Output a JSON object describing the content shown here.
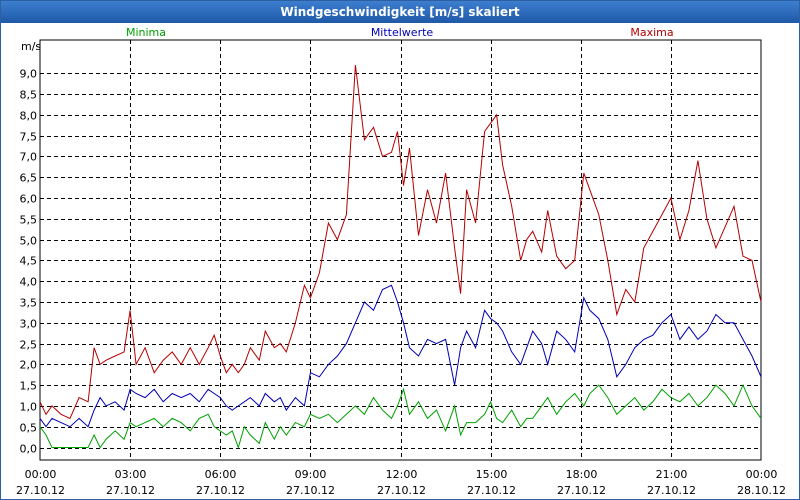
{
  "window": {
    "title": "Windgeschwindigkeit [m/s] skaliert"
  },
  "chart_data": {
    "type": "line",
    "title": "Windgeschwindigkeit [m/s] skaliert",
    "ylabel": "m/s",
    "ylim": [
      -0.3,
      9.8
    ],
    "xlim": [
      0,
      24
    ],
    "grid": true,
    "legend_placement": "top",
    "y_ticks": [
      "0,0",
      "0,5",
      "1,0",
      "1,5",
      "2,0",
      "2,5",
      "3,0",
      "3,5",
      "4,0",
      "4,5",
      "5,0",
      "5,5",
      "6,0",
      "6,5",
      "7,0",
      "7,5",
      "8,0",
      "8,5",
      "9,0"
    ],
    "x_ticks": [
      {
        "time": "00:00",
        "date": "27.10.12"
      },
      {
        "time": "03:00",
        "date": "27.10.12"
      },
      {
        "time": "06:00",
        "date": "27.10.12"
      },
      {
        "time": "09:00",
        "date": "27.10.12"
      },
      {
        "time": "12:00",
        "date": "27.10.12"
      },
      {
        "time": "15:00",
        "date": "27.10.12"
      },
      {
        "time": "18:00",
        "date": "27.10.12"
      },
      {
        "time": "21:00",
        "date": "27.10.12"
      },
      {
        "time": "00:00",
        "date": "28.10.12"
      }
    ],
    "series": [
      {
        "name": "Minima",
        "color": "#00a000",
        "points": [
          [
            0.0,
            0.5
          ],
          [
            0.2,
            0.3
          ],
          [
            0.4,
            0.0
          ],
          [
            0.7,
            0.0
          ],
          [
            1.0,
            0.0
          ],
          [
            1.3,
            0.0
          ],
          [
            1.6,
            0.0
          ],
          [
            1.8,
            0.3
          ],
          [
            2.0,
            0.0
          ],
          [
            2.2,
            0.2
          ],
          [
            2.5,
            0.4
          ],
          [
            2.8,
            0.2
          ],
          [
            3.0,
            0.6
          ],
          [
            3.2,
            0.5
          ],
          [
            3.5,
            0.6
          ],
          [
            3.8,
            0.7
          ],
          [
            4.1,
            0.5
          ],
          [
            4.4,
            0.7
          ],
          [
            4.7,
            0.6
          ],
          [
            5.0,
            0.4
          ],
          [
            5.3,
            0.7
          ],
          [
            5.6,
            0.8
          ],
          [
            5.8,
            0.5
          ],
          [
            6.0,
            0.4
          ],
          [
            6.2,
            0.3
          ],
          [
            6.4,
            0.4
          ],
          [
            6.6,
            0.0
          ],
          [
            6.8,
            0.5
          ],
          [
            7.0,
            0.3
          ],
          [
            7.3,
            0.1
          ],
          [
            7.5,
            0.6
          ],
          [
            7.8,
            0.2
          ],
          [
            8.0,
            0.5
          ],
          [
            8.2,
            0.3
          ],
          [
            8.5,
            0.6
          ],
          [
            8.8,
            0.5
          ],
          [
            9.0,
            0.8
          ],
          [
            9.3,
            0.7
          ],
          [
            9.6,
            0.8
          ],
          [
            9.9,
            0.6
          ],
          [
            10.2,
            0.8
          ],
          [
            10.5,
            1.0
          ],
          [
            10.8,
            0.8
          ],
          [
            11.1,
            1.2
          ],
          [
            11.4,
            0.9
          ],
          [
            11.7,
            0.7
          ],
          [
            11.9,
            1.0
          ],
          [
            12.1,
            1.4
          ],
          [
            12.3,
            0.8
          ],
          [
            12.6,
            1.1
          ],
          [
            12.9,
            0.7
          ],
          [
            13.2,
            0.9
          ],
          [
            13.5,
            0.4
          ],
          [
            13.8,
            1.0
          ],
          [
            14.0,
            0.3
          ],
          [
            14.2,
            0.6
          ],
          [
            14.5,
            0.6
          ],
          [
            14.8,
            0.8
          ],
          [
            15.0,
            1.1
          ],
          [
            15.2,
            0.7
          ],
          [
            15.4,
            0.6
          ],
          [
            15.7,
            0.9
          ],
          [
            16.0,
            0.5
          ],
          [
            16.2,
            0.7
          ],
          [
            16.4,
            0.7
          ],
          [
            16.7,
            1.0
          ],
          [
            16.9,
            1.2
          ],
          [
            17.2,
            0.8
          ],
          [
            17.5,
            1.1
          ],
          [
            17.8,
            1.3
          ],
          [
            18.1,
            1.0
          ],
          [
            18.3,
            1.3
          ],
          [
            18.6,
            1.5
          ],
          [
            18.9,
            1.2
          ],
          [
            19.2,
            0.8
          ],
          [
            19.5,
            1.0
          ],
          [
            19.8,
            1.2
          ],
          [
            20.1,
            0.9
          ],
          [
            20.4,
            1.1
          ],
          [
            20.7,
            1.4
          ],
          [
            21.0,
            1.2
          ],
          [
            21.3,
            1.1
          ],
          [
            21.6,
            1.3
          ],
          [
            21.9,
            1.0
          ],
          [
            22.2,
            1.2
          ],
          [
            22.5,
            1.5
          ],
          [
            22.8,
            1.3
          ],
          [
            23.1,
            1.0
          ],
          [
            23.4,
            1.5
          ],
          [
            23.7,
            1.0
          ],
          [
            24.0,
            0.7
          ]
        ]
      },
      {
        "name": "Mittelwerte",
        "color": "#0000b4",
        "points": [
          [
            0.0,
            0.7
          ],
          [
            0.2,
            0.5
          ],
          [
            0.4,
            0.7
          ],
          [
            0.7,
            0.6
          ],
          [
            1.0,
            0.5
          ],
          [
            1.3,
            0.7
          ],
          [
            1.6,
            0.5
          ],
          [
            1.8,
            0.9
          ],
          [
            2.0,
            1.2
          ],
          [
            2.2,
            1.0
          ],
          [
            2.5,
            1.1
          ],
          [
            2.8,
            0.9
          ],
          [
            3.0,
            1.4
          ],
          [
            3.2,
            1.3
          ],
          [
            3.5,
            1.2
          ],
          [
            3.8,
            1.4
          ],
          [
            4.1,
            1.1
          ],
          [
            4.4,
            1.3
          ],
          [
            4.7,
            1.2
          ],
          [
            5.0,
            1.3
          ],
          [
            5.3,
            1.1
          ],
          [
            5.6,
            1.4
          ],
          [
            5.8,
            1.3
          ],
          [
            6.0,
            1.2
          ],
          [
            6.2,
            1.0
          ],
          [
            6.4,
            0.9
          ],
          [
            6.6,
            1.0
          ],
          [
            6.8,
            1.1
          ],
          [
            7.0,
            1.2
          ],
          [
            7.3,
            1.0
          ],
          [
            7.5,
            1.3
          ],
          [
            7.8,
            1.1
          ],
          [
            8.0,
            1.2
          ],
          [
            8.2,
            0.9
          ],
          [
            8.5,
            1.2
          ],
          [
            8.8,
            1.0
          ],
          [
            9.0,
            1.8
          ],
          [
            9.3,
            1.7
          ],
          [
            9.6,
            2.0
          ],
          [
            9.9,
            2.2
          ],
          [
            10.2,
            2.5
          ],
          [
            10.5,
            3.0
          ],
          [
            10.8,
            3.5
          ],
          [
            11.1,
            3.3
          ],
          [
            11.4,
            3.8
          ],
          [
            11.7,
            3.9
          ],
          [
            11.9,
            3.5
          ],
          [
            12.1,
            3.0
          ],
          [
            12.3,
            2.4
          ],
          [
            12.6,
            2.2
          ],
          [
            12.9,
            2.6
          ],
          [
            13.2,
            2.5
          ],
          [
            13.5,
            2.6
          ],
          [
            13.8,
            1.5
          ],
          [
            14.0,
            2.4
          ],
          [
            14.2,
            2.8
          ],
          [
            14.5,
            2.4
          ],
          [
            14.8,
            3.3
          ],
          [
            15.0,
            3.1
          ],
          [
            15.2,
            3.0
          ],
          [
            15.4,
            2.8
          ],
          [
            15.7,
            2.3
          ],
          [
            16.0,
            2.0
          ],
          [
            16.2,
            2.4
          ],
          [
            16.4,
            2.8
          ],
          [
            16.7,
            2.5
          ],
          [
            16.9,
            2.0
          ],
          [
            17.2,
            2.8
          ],
          [
            17.5,
            2.6
          ],
          [
            17.8,
            2.3
          ],
          [
            18.1,
            3.6
          ],
          [
            18.3,
            3.3
          ],
          [
            18.6,
            3.1
          ],
          [
            18.9,
            2.6
          ],
          [
            19.2,
            1.7
          ],
          [
            19.5,
            2.0
          ],
          [
            19.8,
            2.4
          ],
          [
            20.1,
            2.6
          ],
          [
            20.4,
            2.7
          ],
          [
            20.7,
            3.0
          ],
          [
            21.0,
            3.2
          ],
          [
            21.3,
            2.6
          ],
          [
            21.6,
            2.9
          ],
          [
            21.9,
            2.6
          ],
          [
            22.2,
            2.8
          ],
          [
            22.5,
            3.2
          ],
          [
            22.8,
            3.0
          ],
          [
            23.1,
            3.0
          ],
          [
            23.4,
            2.6
          ],
          [
            23.7,
            2.2
          ],
          [
            24.0,
            1.7
          ]
        ]
      },
      {
        "name": "Maxima",
        "color": "#b40000",
        "points": [
          [
            0.0,
            1.1
          ],
          [
            0.2,
            0.8
          ],
          [
            0.4,
            1.0
          ],
          [
            0.7,
            0.8
          ],
          [
            1.0,
            0.7
          ],
          [
            1.3,
            1.2
          ],
          [
            1.6,
            1.1
          ],
          [
            1.8,
            2.4
          ],
          [
            2.0,
            2.0
          ],
          [
            2.2,
            2.1
          ],
          [
            2.5,
            2.2
          ],
          [
            2.8,
            2.3
          ],
          [
            3.0,
            3.3
          ],
          [
            3.2,
            2.0
          ],
          [
            3.5,
            2.4
          ],
          [
            3.8,
            1.8
          ],
          [
            4.1,
            2.1
          ],
          [
            4.4,
            2.3
          ],
          [
            4.7,
            2.0
          ],
          [
            5.0,
            2.4
          ],
          [
            5.3,
            2.0
          ],
          [
            5.6,
            2.4
          ],
          [
            5.8,
            2.7
          ],
          [
            6.0,
            2.2
          ],
          [
            6.2,
            1.8
          ],
          [
            6.4,
            2.0
          ],
          [
            6.6,
            1.8
          ],
          [
            6.8,
            2.0
          ],
          [
            7.0,
            2.4
          ],
          [
            7.3,
            2.1
          ],
          [
            7.5,
            2.8
          ],
          [
            7.8,
            2.4
          ],
          [
            8.0,
            2.5
          ],
          [
            8.2,
            2.3
          ],
          [
            8.5,
            3.0
          ],
          [
            8.8,
            3.9
          ],
          [
            9.0,
            3.6
          ],
          [
            9.3,
            4.2
          ],
          [
            9.6,
            5.4
          ],
          [
            9.9,
            5.0
          ],
          [
            10.2,
            5.6
          ],
          [
            10.5,
            9.2
          ],
          [
            10.8,
            7.4
          ],
          [
            11.1,
            7.7
          ],
          [
            11.4,
            7.0
          ],
          [
            11.7,
            7.1
          ],
          [
            11.9,
            7.6
          ],
          [
            12.1,
            6.3
          ],
          [
            12.3,
            7.2
          ],
          [
            12.6,
            5.1
          ],
          [
            12.9,
            6.2
          ],
          [
            13.2,
            5.4
          ],
          [
            13.5,
            6.6
          ],
          [
            13.8,
            4.8
          ],
          [
            14.0,
            3.7
          ],
          [
            14.2,
            6.2
          ],
          [
            14.5,
            5.4
          ],
          [
            14.8,
            7.6
          ],
          [
            15.0,
            7.8
          ],
          [
            15.2,
            8.0
          ],
          [
            15.4,
            6.8
          ],
          [
            15.7,
            5.8
          ],
          [
            16.0,
            4.5
          ],
          [
            16.2,
            5.0
          ],
          [
            16.4,
            5.2
          ],
          [
            16.7,
            4.7
          ],
          [
            16.9,
            5.7
          ],
          [
            17.2,
            4.6
          ],
          [
            17.5,
            4.3
          ],
          [
            17.8,
            4.5
          ],
          [
            18.1,
            6.6
          ],
          [
            18.3,
            6.2
          ],
          [
            18.6,
            5.6
          ],
          [
            18.9,
            4.5
          ],
          [
            19.2,
            3.2
          ],
          [
            19.5,
            3.8
          ],
          [
            19.8,
            3.5
          ],
          [
            20.1,
            4.8
          ],
          [
            20.4,
            5.2
          ],
          [
            20.7,
            5.6
          ],
          [
            21.0,
            6.0
          ],
          [
            21.3,
            5.0
          ],
          [
            21.6,
            5.7
          ],
          [
            21.9,
            6.9
          ],
          [
            22.2,
            5.5
          ],
          [
            22.5,
            4.8
          ],
          [
            22.8,
            5.3
          ],
          [
            23.1,
            5.8
          ],
          [
            23.4,
            4.6
          ],
          [
            23.7,
            4.5
          ],
          [
            24.0,
            3.5
          ]
        ]
      }
    ]
  }
}
